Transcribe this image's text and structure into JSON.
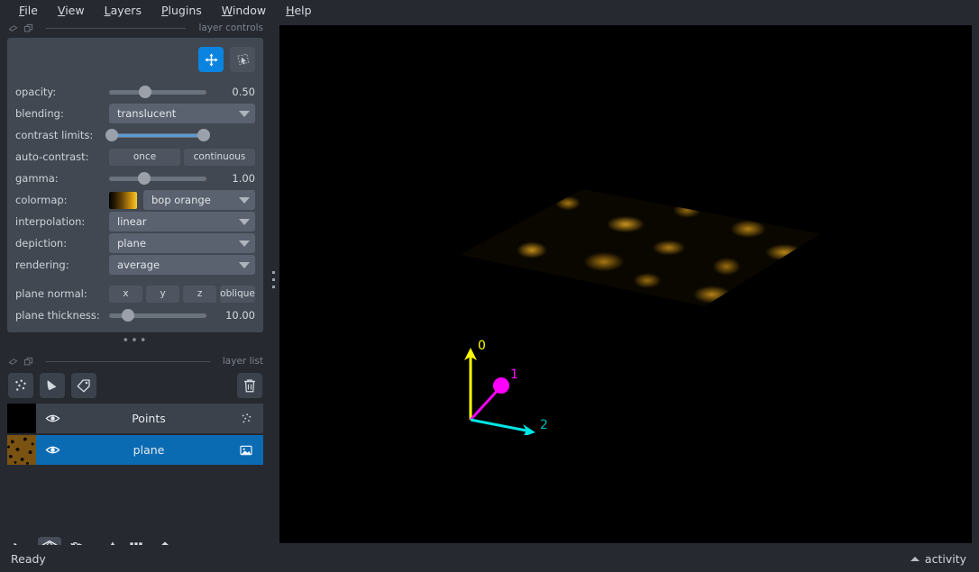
{
  "menubar": {
    "items": [
      {
        "label": "File",
        "accel": "F"
      },
      {
        "label": "View",
        "accel": "V"
      },
      {
        "label": "Layers",
        "accel": "L"
      },
      {
        "label": "Plugins",
        "accel": "P"
      },
      {
        "label": "Window",
        "accel": "W"
      },
      {
        "label": "Help",
        "accel": "H"
      }
    ]
  },
  "layer_controls": {
    "title": "layer controls",
    "tools": [
      {
        "name": "pan-zoom-tool",
        "icon": "move-arrows-icon",
        "active": true
      },
      {
        "name": "transform-tool",
        "icon": "transform-cursor-icon",
        "active": false
      }
    ],
    "opacity": {
      "label": "opacity:",
      "value": "0.50",
      "handle_pct": 37
    },
    "blending": {
      "label": "blending:",
      "value": "translucent"
    },
    "contrast_limits": {
      "label": "contrast limits:",
      "low_pct": 3,
      "high_pct": 97
    },
    "auto_contrast": {
      "label": "auto-contrast:",
      "once": "once",
      "continuous": "continuous"
    },
    "gamma": {
      "label": "gamma:",
      "value": "1.00",
      "handle_pct": 36
    },
    "colormap": {
      "label": "colormap:",
      "value": "bop orange"
    },
    "interpolation": {
      "label": "interpolation:",
      "value": "linear"
    },
    "depiction": {
      "label": "depiction:",
      "value": "plane"
    },
    "rendering": {
      "label": "rendering:",
      "value": "average"
    },
    "plane_normal": {
      "label": "plane normal:",
      "buttons": [
        "x",
        "y",
        "z",
        "oblique"
      ]
    },
    "plane_thickness": {
      "label": "plane thickness:",
      "value": "10.00",
      "handle_pct": 19
    }
  },
  "layer_list": {
    "title": "layer list",
    "buttons": [
      {
        "name": "new-points-button",
        "icon": "points-icon"
      },
      {
        "name": "new-shapes-button",
        "icon": "shapes-icon"
      },
      {
        "name": "new-labels-button",
        "icon": "labels-tag-icon"
      },
      {
        "name": "delete-layer-button",
        "icon": "trash-icon"
      }
    ],
    "layers": [
      {
        "name": "Points",
        "type": "points",
        "visible": true,
        "selected": false,
        "thumb": "black"
      },
      {
        "name": "plane",
        "type": "image",
        "visible": true,
        "selected": true,
        "thumb": "noise"
      }
    ]
  },
  "viewer_buttons": [
    {
      "name": "console-button",
      "icon": "terminal-icon",
      "active": false
    },
    {
      "name": "ndisplay-toggle-button",
      "icon": "cube-3d-icon",
      "active": true
    },
    {
      "name": "roll-dims-button",
      "icon": "roll-cube-icon",
      "active": false
    },
    {
      "name": "transpose-dims-button",
      "icon": "transpose-icon",
      "active": false
    },
    {
      "name": "grid-view-button",
      "icon": "grid-icon",
      "active": false
    },
    {
      "name": "reset-view-button",
      "icon": "home-icon",
      "active": false
    }
  ],
  "canvas": {
    "background": "#000000",
    "axes": [
      {
        "label": "0",
        "color": "#ffff00"
      },
      {
        "label": "1",
        "color": "#ff00ff"
      },
      {
        "label": "2",
        "color": "#00e5e5"
      }
    ]
  },
  "statusbar": {
    "message": "Ready",
    "activity_label": "activity"
  },
  "colors": {
    "window_bg": "#262930",
    "panel_bg": "#414851",
    "field_bg": "#5a6270",
    "accent_blue": "#0a84e0",
    "selected_row": "#0a6bb3",
    "text": "#d0d3d8",
    "muted_text": "#7c838f"
  }
}
